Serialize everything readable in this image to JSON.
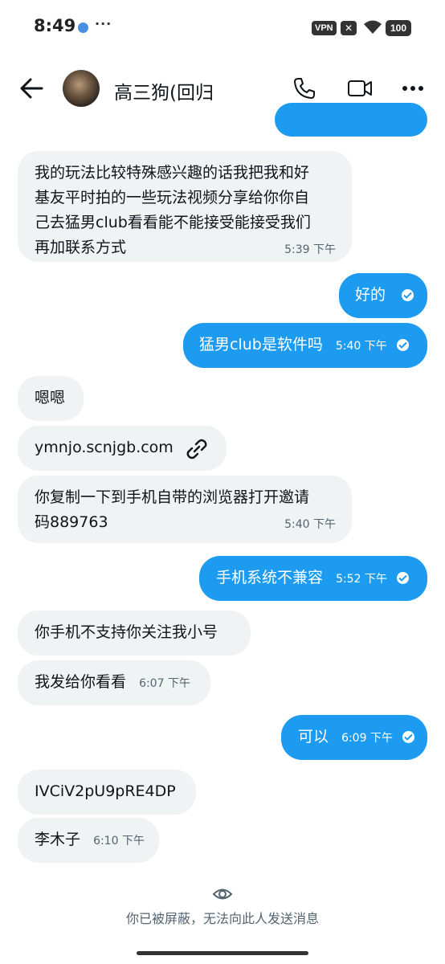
{
  "status_bar": {
    "time": "8:49",
    "more": "···",
    "vpn_label": "VPN",
    "x_label": "✕",
    "battery": "100"
  },
  "header": {
    "contact_name": "高三狗(回归",
    "icons": [
      "back-arrow-icon",
      "phone-icon",
      "video-icon",
      "more-icon"
    ]
  },
  "messages": [
    {
      "direction": "in",
      "text_lines": [
        "我的玩法比较特殊感兴趣的话我把我和好",
        "基友平时拍的一些玩法视频分享给你你自",
        "己去猛男club看看能不能接受能接受我们",
        "再加联系方式"
      ],
      "time": "5:39 下午"
    },
    {
      "direction": "out",
      "text": "好的",
      "time": "",
      "read": true
    },
    {
      "direction": "out",
      "text": "猛男club是软件吗",
      "time": "5:40 下午",
      "read": true
    },
    {
      "direction": "in",
      "text": "嗯嗯",
      "time": ""
    },
    {
      "direction": "in",
      "text": "ymnjo.scnjgb.com",
      "time": "",
      "link_icon": "link-icon"
    },
    {
      "direction": "in",
      "text_lines": [
        "你复制一下到手机自带的浏览器打开邀请",
        "码889763"
      ],
      "time": "5:40 下午"
    },
    {
      "direction": "out",
      "text": "手机系统不兼容",
      "time": "5:52 下午",
      "read": true
    },
    {
      "direction": "in",
      "text": "你手机不支持你关注我小号",
      "time": ""
    },
    {
      "direction": "in",
      "text": "我发给你看看",
      "time": "6:07 下午"
    },
    {
      "direction": "out",
      "text": "可以",
      "time": "6:09 下午",
      "read": true
    },
    {
      "direction": "in",
      "text": "IVCiV2pU9pRE4DP",
      "time": ""
    },
    {
      "direction": "in",
      "text": "李木子",
      "time": "6:10 下午"
    }
  ],
  "footer": {
    "icon": "eye-icon",
    "notice": "你已被屏蔽，无法向此人发送消息"
  },
  "colors": {
    "outgoing_bubble": "#1d9bf0",
    "incoming_bubble": "#eff3f4",
    "text_primary": "#0f1419",
    "text_secondary": "#536471"
  }
}
